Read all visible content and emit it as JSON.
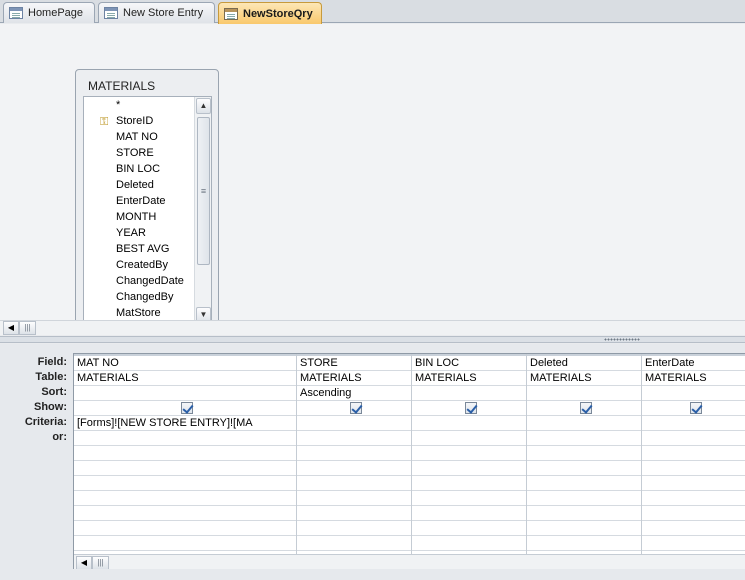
{
  "tabs": [
    {
      "label": "HomePage",
      "icon": "form-icon"
    },
    {
      "label": "New Store Entry",
      "icon": "form-icon"
    },
    {
      "label": "NewStoreQry",
      "icon": "query-icon",
      "active": true
    }
  ],
  "field_list": {
    "title": "MATERIALS",
    "fields": [
      "*",
      "StoreID",
      "MAT NO",
      "STORE",
      "BIN LOC",
      "Deleted",
      "EnterDate",
      "MONTH",
      "YEAR",
      "BEST AVG",
      "CreatedBy",
      "ChangedDate",
      "ChangedBy",
      "MatStore"
    ],
    "primary_key": "StoreID"
  },
  "grid": {
    "row_labels": [
      "Field:",
      "Table:",
      "Sort:",
      "Show:",
      "Criteria:",
      "or:"
    ],
    "columns": [
      {
        "field": "MAT NO",
        "table": "MATERIALS",
        "sort": "",
        "show": true,
        "criteria": "[Forms]![NEW STORE ENTRY]![MA",
        "or": ""
      },
      {
        "field": "STORE",
        "table": "MATERIALS",
        "sort": "Ascending",
        "show": true,
        "criteria": "",
        "or": ""
      },
      {
        "field": "BIN LOC",
        "table": "MATERIALS",
        "sort": "",
        "show": true,
        "criteria": "",
        "or": ""
      },
      {
        "field": "Deleted",
        "table": "MATERIALS",
        "sort": "",
        "show": true,
        "criteria": "",
        "or": ""
      },
      {
        "field": "EnterDate",
        "table": "MATERIALS",
        "sort": "",
        "show": true,
        "criteria": "",
        "or": ""
      }
    ]
  }
}
